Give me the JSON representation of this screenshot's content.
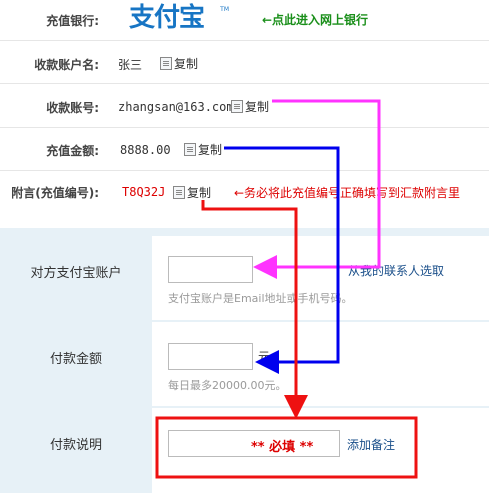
{
  "rows": {
    "bank": {
      "label": "充值银行:",
      "logo_text": "支付宝",
      "note": "←点此进入网上银行"
    },
    "name": {
      "label": "收款账户名:",
      "value": "张三",
      "copy": "复制"
    },
    "account": {
      "label": "收款账号:",
      "value": "zhangsan@163.com",
      "copy": "复制"
    },
    "amount": {
      "label": "充值金额:",
      "value": "8888.00",
      "copy": "复制"
    },
    "memo": {
      "label": "附言(充值编号):",
      "value": "T8Q32J",
      "copy": "复制",
      "note": "←务必将此充值编号正确填写到汇款附言里"
    }
  },
  "form": {
    "account": {
      "label": "对方支付宝账户",
      "link": "从我的联系人选取",
      "hint": "支付宝账户是Email地址或手机号码。"
    },
    "amount": {
      "label": "付款金额",
      "unit": "元",
      "hint": "每日最多20000.00元。"
    },
    "memo": {
      "label": "付款说明",
      "required_text": "** 必填 **",
      "link": "添加备注"
    }
  },
  "colors": {
    "pink_arrow": "#ff33ff",
    "blue_arrow": "#0000ee",
    "red_arrow": "#ee1111",
    "form_bg": "#e7f1f7",
    "logo": "#1775c4"
  }
}
